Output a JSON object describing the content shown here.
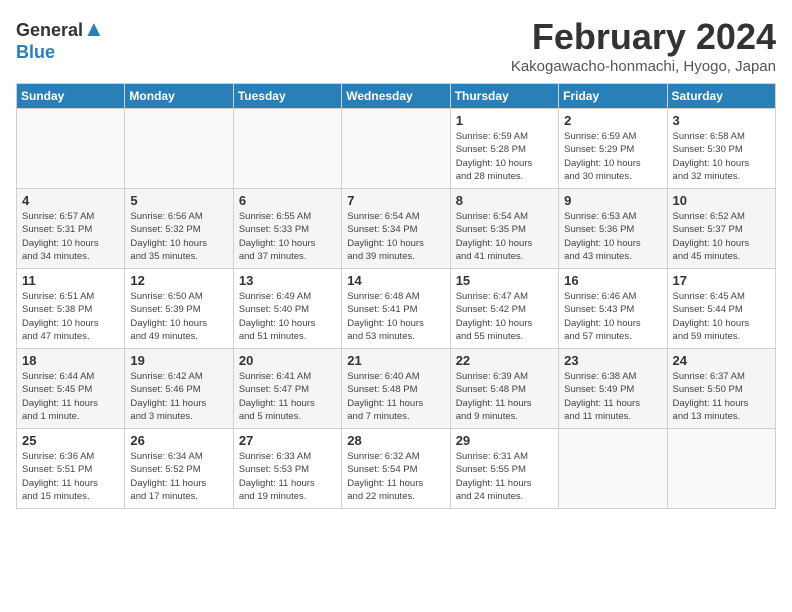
{
  "header": {
    "logo_general": "General",
    "logo_blue": "Blue",
    "title": "February 2024",
    "subtitle": "Kakogawacho-honmachi, Hyogo, Japan"
  },
  "weekdays": [
    "Sunday",
    "Monday",
    "Tuesday",
    "Wednesday",
    "Thursday",
    "Friday",
    "Saturday"
  ],
  "weeks": [
    [
      {
        "day": "",
        "info": ""
      },
      {
        "day": "",
        "info": ""
      },
      {
        "day": "",
        "info": ""
      },
      {
        "day": "",
        "info": ""
      },
      {
        "day": "1",
        "info": "Sunrise: 6:59 AM\nSunset: 5:28 PM\nDaylight: 10 hours\nand 28 minutes."
      },
      {
        "day": "2",
        "info": "Sunrise: 6:59 AM\nSunset: 5:29 PM\nDaylight: 10 hours\nand 30 minutes."
      },
      {
        "day": "3",
        "info": "Sunrise: 6:58 AM\nSunset: 5:30 PM\nDaylight: 10 hours\nand 32 minutes."
      }
    ],
    [
      {
        "day": "4",
        "info": "Sunrise: 6:57 AM\nSunset: 5:31 PM\nDaylight: 10 hours\nand 34 minutes."
      },
      {
        "day": "5",
        "info": "Sunrise: 6:56 AM\nSunset: 5:32 PM\nDaylight: 10 hours\nand 35 minutes."
      },
      {
        "day": "6",
        "info": "Sunrise: 6:55 AM\nSunset: 5:33 PM\nDaylight: 10 hours\nand 37 minutes."
      },
      {
        "day": "7",
        "info": "Sunrise: 6:54 AM\nSunset: 5:34 PM\nDaylight: 10 hours\nand 39 minutes."
      },
      {
        "day": "8",
        "info": "Sunrise: 6:54 AM\nSunset: 5:35 PM\nDaylight: 10 hours\nand 41 minutes."
      },
      {
        "day": "9",
        "info": "Sunrise: 6:53 AM\nSunset: 5:36 PM\nDaylight: 10 hours\nand 43 minutes."
      },
      {
        "day": "10",
        "info": "Sunrise: 6:52 AM\nSunset: 5:37 PM\nDaylight: 10 hours\nand 45 minutes."
      }
    ],
    [
      {
        "day": "11",
        "info": "Sunrise: 6:51 AM\nSunset: 5:38 PM\nDaylight: 10 hours\nand 47 minutes."
      },
      {
        "day": "12",
        "info": "Sunrise: 6:50 AM\nSunset: 5:39 PM\nDaylight: 10 hours\nand 49 minutes."
      },
      {
        "day": "13",
        "info": "Sunrise: 6:49 AM\nSunset: 5:40 PM\nDaylight: 10 hours\nand 51 minutes."
      },
      {
        "day": "14",
        "info": "Sunrise: 6:48 AM\nSunset: 5:41 PM\nDaylight: 10 hours\nand 53 minutes."
      },
      {
        "day": "15",
        "info": "Sunrise: 6:47 AM\nSunset: 5:42 PM\nDaylight: 10 hours\nand 55 minutes."
      },
      {
        "day": "16",
        "info": "Sunrise: 6:46 AM\nSunset: 5:43 PM\nDaylight: 10 hours\nand 57 minutes."
      },
      {
        "day": "17",
        "info": "Sunrise: 6:45 AM\nSunset: 5:44 PM\nDaylight: 10 hours\nand 59 minutes."
      }
    ],
    [
      {
        "day": "18",
        "info": "Sunrise: 6:44 AM\nSunset: 5:45 PM\nDaylight: 11 hours\nand 1 minute."
      },
      {
        "day": "19",
        "info": "Sunrise: 6:42 AM\nSunset: 5:46 PM\nDaylight: 11 hours\nand 3 minutes."
      },
      {
        "day": "20",
        "info": "Sunrise: 6:41 AM\nSunset: 5:47 PM\nDaylight: 11 hours\nand 5 minutes."
      },
      {
        "day": "21",
        "info": "Sunrise: 6:40 AM\nSunset: 5:48 PM\nDaylight: 11 hours\nand 7 minutes."
      },
      {
        "day": "22",
        "info": "Sunrise: 6:39 AM\nSunset: 5:48 PM\nDaylight: 11 hours\nand 9 minutes."
      },
      {
        "day": "23",
        "info": "Sunrise: 6:38 AM\nSunset: 5:49 PM\nDaylight: 11 hours\nand 11 minutes."
      },
      {
        "day": "24",
        "info": "Sunrise: 6:37 AM\nSunset: 5:50 PM\nDaylight: 11 hours\nand 13 minutes."
      }
    ],
    [
      {
        "day": "25",
        "info": "Sunrise: 6:36 AM\nSunset: 5:51 PM\nDaylight: 11 hours\nand 15 minutes."
      },
      {
        "day": "26",
        "info": "Sunrise: 6:34 AM\nSunset: 5:52 PM\nDaylight: 11 hours\nand 17 minutes."
      },
      {
        "day": "27",
        "info": "Sunrise: 6:33 AM\nSunset: 5:53 PM\nDaylight: 11 hours\nand 19 minutes."
      },
      {
        "day": "28",
        "info": "Sunrise: 6:32 AM\nSunset: 5:54 PM\nDaylight: 11 hours\nand 22 minutes."
      },
      {
        "day": "29",
        "info": "Sunrise: 6:31 AM\nSunset: 5:55 PM\nDaylight: 11 hours\nand 24 minutes."
      },
      {
        "day": "",
        "info": ""
      },
      {
        "day": "",
        "info": ""
      }
    ]
  ]
}
